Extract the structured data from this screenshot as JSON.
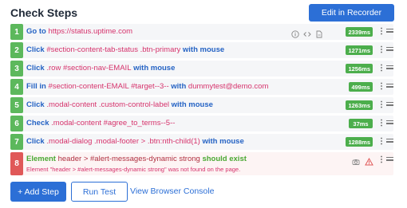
{
  "header": {
    "title": "Check Steps",
    "edit_button": "Edit in Recorder"
  },
  "steps": [
    {
      "num": "1",
      "parts": [
        [
          "act",
          "Go to"
        ],
        [
          "val",
          " https://status.uptime.com"
        ]
      ],
      "time": "2339ms",
      "status": "ok"
    },
    {
      "num": "2",
      "parts": [
        [
          "act",
          "Click"
        ],
        [
          "tgt",
          " #section-content-tab-status .btn-primary"
        ],
        [
          "kw",
          " with mouse"
        ]
      ],
      "time": "1271ms",
      "status": "ok"
    },
    {
      "num": "3",
      "parts": [
        [
          "act",
          "Click"
        ],
        [
          "tgt",
          " .row #section-nav-EMAIL"
        ],
        [
          "kw",
          " with mouse"
        ]
      ],
      "time": "1256ms",
      "status": "ok"
    },
    {
      "num": "4",
      "parts": [
        [
          "act",
          "Fill in"
        ],
        [
          "tgt",
          " #section-content-EMAIL #target--3--"
        ],
        [
          "kw",
          " with"
        ],
        [
          "val",
          " dummytest@demo.com"
        ]
      ],
      "time": "499ms",
      "status": "ok"
    },
    {
      "num": "5",
      "parts": [
        [
          "act",
          "Click"
        ],
        [
          "tgt",
          " .modal-content .custom-control-label"
        ],
        [
          "kw",
          " with mouse"
        ]
      ],
      "time": "1263ms",
      "status": "ok"
    },
    {
      "num": "6",
      "parts": [
        [
          "act",
          "Check"
        ],
        [
          "tgt",
          " .modal-content #agree_to_terms--5--"
        ]
      ],
      "time": "37ms",
      "status": "ok"
    },
    {
      "num": "7",
      "parts": [
        [
          "act",
          "Click"
        ],
        [
          "tgt",
          " .modal-dialog .modal-footer > .btn:nth-child(1)"
        ],
        [
          "kw",
          " with mouse"
        ]
      ],
      "time": "1288ms",
      "status": "ok"
    },
    {
      "num": "8",
      "parts": [
        [
          "act",
          "Element"
        ],
        [
          "tgt",
          " header > #alert-messages-dynamic strong"
        ],
        [
          "kw",
          " should exist"
        ]
      ],
      "error": "Element \"header > #alert-messages-dynamic strong\" was not found on the page.",
      "status": "error"
    }
  ],
  "icons": {
    "step1": [
      "info-icon",
      "code-icon",
      "file-icon"
    ],
    "step8": [
      "camera-icon",
      "warning-icon"
    ],
    "kebab": "⋮"
  },
  "footer": {
    "add_step": "+ Add Step",
    "run_test": "Run Test",
    "view_console": "View Browser Console"
  },
  "colors": {
    "primary": "#2c6fd6",
    "success": "#5cb85c",
    "danger": "#e05858",
    "target": "#d6336c"
  }
}
